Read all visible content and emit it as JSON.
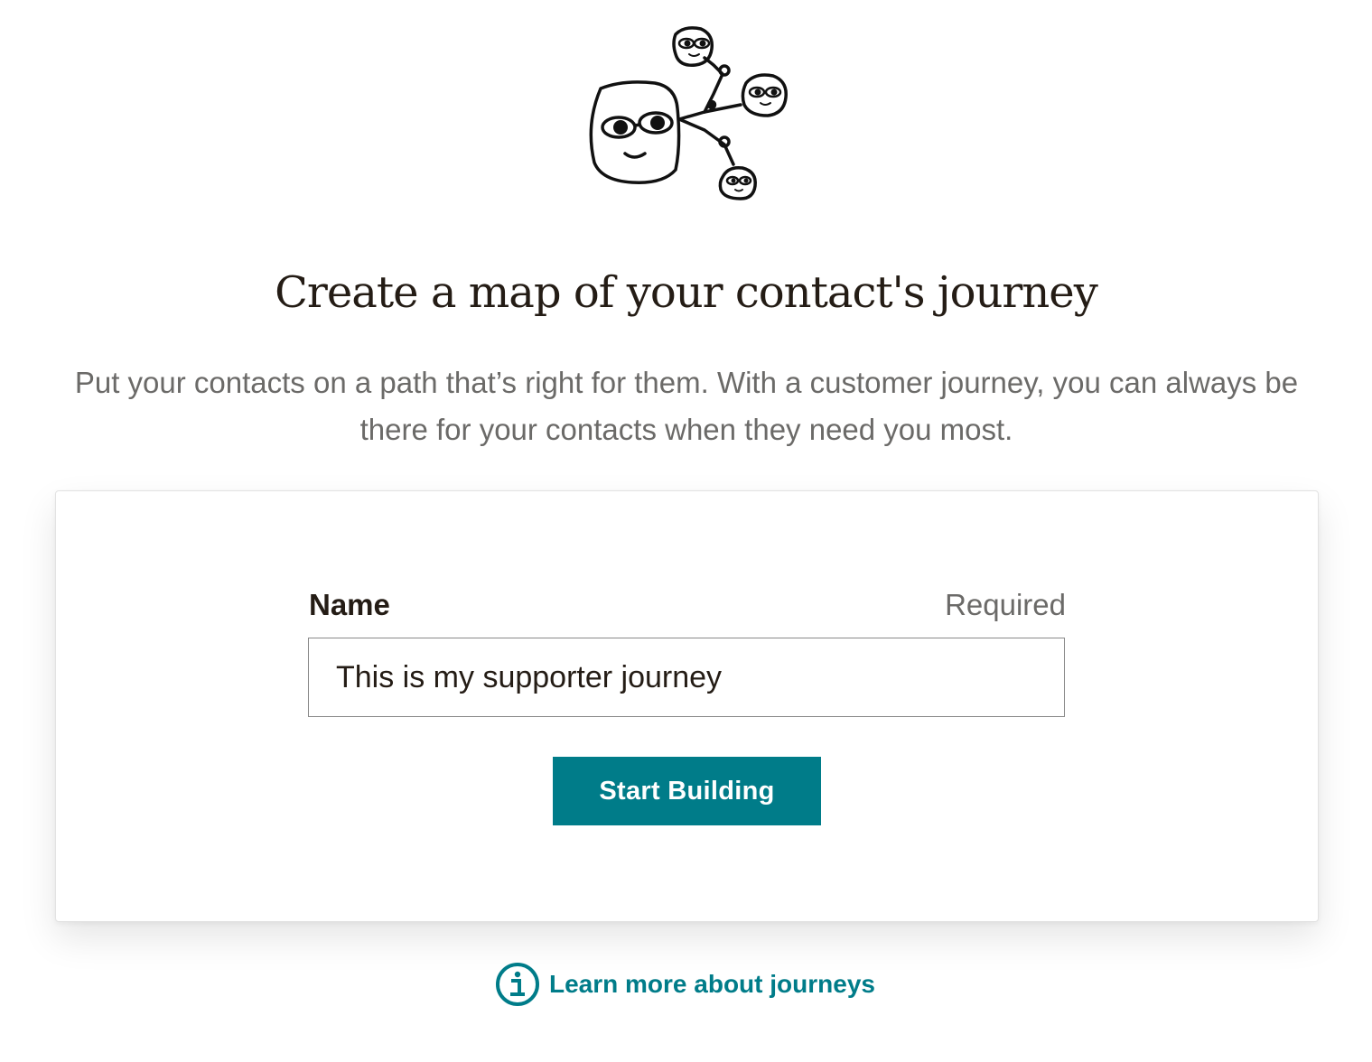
{
  "illustration": {
    "icon": "connected-faces-illustration"
  },
  "header": {
    "title": "Create a map of your contact's journey",
    "subtitle": "Put your contacts on a path that’s right for them. With a customer journey, you can always be there for your contacts when they need you most."
  },
  "form": {
    "name_label": "Name",
    "required_label": "Required",
    "name_value": "This is my supporter journey",
    "submit_label": "Start Building"
  },
  "footer": {
    "learn_more_label": "Learn more about journeys",
    "icon": "info-icon"
  },
  "colors": {
    "accent": "#007c89",
    "text_primary": "#241c15",
    "text_secondary": "#6b6a68"
  }
}
